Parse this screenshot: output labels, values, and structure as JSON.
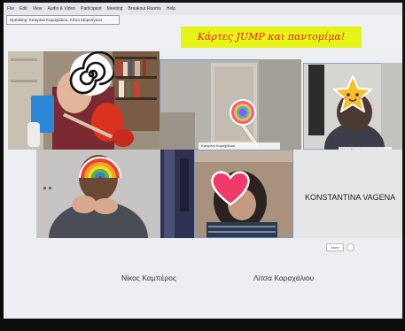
{
  "menu": [
    "File",
    "Edit",
    "View",
    "Audio & Video",
    "Participant",
    "Meeting",
    "Breakout Rooms",
    "Help"
  ],
  "speaking": "Speaking: Κατερίνα Καραχάλιου, Λίτσα Μαρούγκου",
  "banner": "Κάρτες JUMP και παντομίμα!",
  "participants": {
    "tile2_label": "Κατερίνα Καραχάλιου",
    "tile3_label": "Λίτσα Μαρούγκου",
    "name_only": "KONSTANTINA VAGENA",
    "bottom_left": "Νίκος Καμπέρος",
    "bottom_right": "Λίτσα Καραχάλιου"
  },
  "more_button": "More",
  "stickers": [
    "spiral-sticker",
    "lollipop-sticker",
    "star-sticker",
    "rainbow-sticker",
    "heart-sticker"
  ],
  "colors": {
    "banner_bg": "#e6f416",
    "banner_text": "#ee1d27",
    "heart": "#ef3a6a",
    "star": "#f6c026",
    "tile_border": "#6f9ad8"
  }
}
